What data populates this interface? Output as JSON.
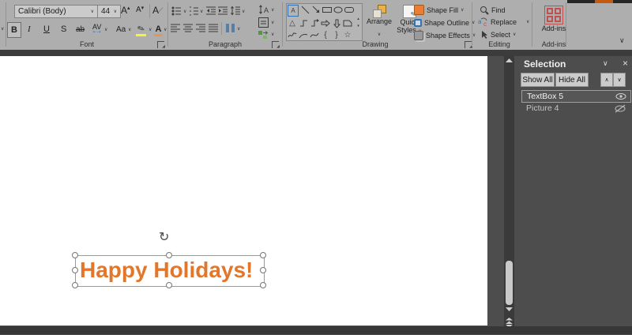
{
  "ribbon": {
    "font": {
      "group_label": "Font",
      "font_name": "Calibri (Body)",
      "font_size": "44",
      "grow_font": "A",
      "shrink_font": "A",
      "clear_format": "A",
      "bold": "B",
      "italic": "I",
      "underline": "U",
      "strike": "S",
      "strikethrough_ab": "ab",
      "char_spacing": "AV",
      "change_case": "Aa",
      "font_color_letter": "A"
    },
    "paragraph": {
      "group_label": "Paragraph"
    },
    "drawing": {
      "group_label": "Drawing",
      "arrange": "Arrange",
      "quick": "Quick",
      "styles": "Styles",
      "shape_fill": "Shape Fill",
      "shape_outline": "Shape Outline",
      "shape_effects": "Shape Effects",
      "shape_icons": [
        "text-box",
        "line",
        "line-arrow",
        "rectangle",
        "oval",
        "rounded-rectangle",
        "triangle",
        "elbow-connector",
        "elbow-arrow-connector",
        "right-arrow",
        "down-arrow",
        "corner-shape",
        "freeform",
        "arc",
        "curve",
        "left-brace",
        "right-brace",
        "star"
      ]
    },
    "editing": {
      "group_label": "Editing",
      "find": "Find",
      "replace": "Replace",
      "select": "Select"
    },
    "addins": {
      "group_label": "Add-ins",
      "button_label": "Add-ins"
    }
  },
  "slide": {
    "textbox_text": "Happy Holidays!"
  },
  "selection_pane": {
    "title": "Selection",
    "show_all": "Show All",
    "hide_all": "Hide All",
    "items": [
      {
        "name": "TextBox 5"
      },
      {
        "name": "Picture 4"
      }
    ]
  },
  "colors": {
    "text_orange": "#e2772c",
    "ribbon_bg": "#aeaeae",
    "panel_bg": "#4d4d4d",
    "addins_red": "#c0504d",
    "outline_blue": "#2e74b5",
    "highlight_yellow": "#f4f43a"
  }
}
